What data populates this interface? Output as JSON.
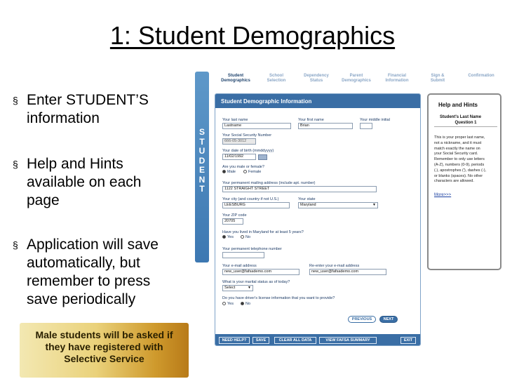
{
  "slide": {
    "title": "1: Student Demographics",
    "bullet_glyph": "§",
    "bullets": [
      {
        "lines": [
          "Enter STUDENT’S",
          "information"
        ]
      },
      {
        "lines": [
          "Help and Hints",
          "available on each",
          "page"
        ]
      },
      {
        "lines": [
          "Application will save",
          "automatically, but",
          "remember to press",
          "save periodically"
        ]
      }
    ],
    "callout_lines": [
      "Male students will be asked if",
      "they have registered with",
      "Selective Service"
    ]
  },
  "screenshot": {
    "vertical_tab_letters": [
      "S",
      "T",
      "U",
      "D",
      "E",
      "N",
      "T"
    ],
    "tabs": [
      {
        "lines": [
          "Student",
          "Demographics"
        ],
        "active": true
      },
      {
        "lines": [
          "School",
          "Selection"
        ],
        "active": false
      },
      {
        "lines": [
          "Dependency",
          "Status"
        ],
        "active": false
      },
      {
        "lines": [
          "Parent",
          "Demographics"
        ],
        "active": false
      },
      {
        "lines": [
          "Financial",
          "Information"
        ],
        "active": false
      },
      {
        "lines": [
          "Sign &",
          "Submit"
        ],
        "active": false
      },
      {
        "lines": [
          "Confirmation"
        ],
        "active": false
      }
    ],
    "form": {
      "header": "Student Demographic Information",
      "last_name": {
        "label": "Your last name",
        "value": "Lastname"
      },
      "first_name": {
        "label": "Your first name",
        "value": "Brian"
      },
      "middle_initial": {
        "label": "Your middle initial",
        "value": ""
      },
      "ssn": {
        "label": "Your Social Security Number",
        "value": "666-05-3012"
      },
      "dob": {
        "label": "Your date of birth (mmddyyyy)",
        "value": "11/02/1992"
      },
      "gender": {
        "label": "Are you male or female?",
        "options": [
          "Male",
          "Female"
        ],
        "selected": "Male"
      },
      "address": {
        "label": "Your permanent mailing address (include apt. number)",
        "value": "1122 STRAIGHT STREET"
      },
      "city": {
        "label": "Your city (and country if not U.S.)",
        "value": "LEESBURG"
      },
      "state": {
        "label": "Your state",
        "value": "Maryland"
      },
      "zip": {
        "label": "Your ZIP code",
        "value": "20705"
      },
      "residency": {
        "label": "Have you lived in Maryland for at least 5 years?",
        "options": [
          "Yes",
          "No"
        ],
        "selected": "Yes"
      },
      "phone": {
        "label": "Your permanent telephone number",
        "value": ""
      },
      "email": {
        "label": "Your e-mail address",
        "value": "new_user@fafsademo.com"
      },
      "email_confirm": {
        "label": "Re-enter your e-mail address",
        "value": "new_user@fafsademo.com"
      },
      "marital": {
        "label": "What is your marital status as of today?",
        "value": "Select"
      },
      "license": {
        "label": "Do you have driver's license information that you want to provide?",
        "options": [
          "Yes",
          "No"
        ],
        "selected": "No"
      },
      "previous_label": "PREVIOUS",
      "next_label": "NEXT",
      "bottom_buttons": [
        "NEED HELP?",
        "SAVE",
        "CLEAR ALL DATA",
        "VIEW FAFSA SUMMARY",
        "EXIT"
      ]
    },
    "help": {
      "title": "Help and Hints",
      "field": "Student's Last Name",
      "question": "Question 1",
      "text_lines": [
        "This is your proper last name,",
        "not a nickname, and it must",
        "match exactly the name on",
        "your Social Security card.",
        "Remember to only use letters",
        "(A-Z), numbers (0-9), periods",
        "(.), apostrophes ('), dashes (-),",
        "or blanks (spaces). No other",
        "characters are allowed."
      ],
      "more": "More>>>"
    }
  }
}
